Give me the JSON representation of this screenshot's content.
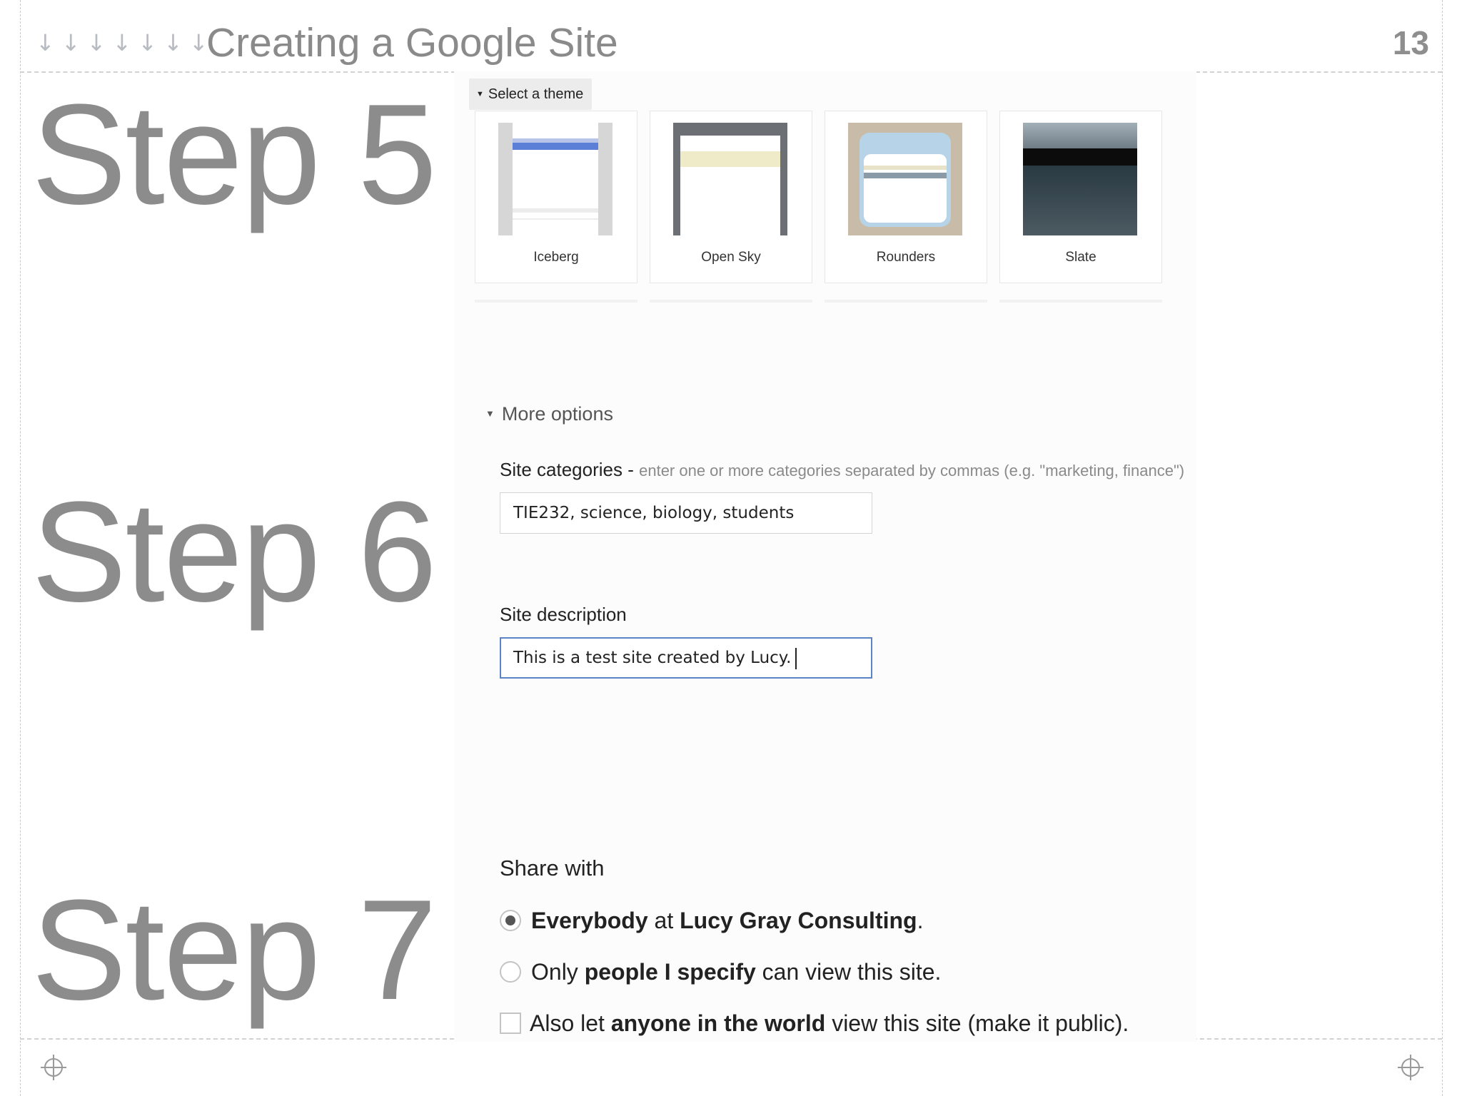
{
  "slide": {
    "title": "Creating a Google Site",
    "page_number": "13",
    "decor_arrows": [
      "↓",
      "↓",
      "↓",
      "↓",
      "↓",
      "↓",
      "↓"
    ]
  },
  "steps": {
    "step5": "Step 5",
    "step6": "Step 6",
    "step7": "Step 7"
  },
  "theme_section": {
    "header": "Select a theme",
    "themes": [
      {
        "name": "Iceberg"
      },
      {
        "name": "Open Sky"
      },
      {
        "name": "Rounders"
      },
      {
        "name": "Slate"
      }
    ]
  },
  "more_options": {
    "label": "More options",
    "categories_label": "Site categories -",
    "categories_hint": "enter one or more categories separated by commas (e.g. \"marketing, finance\")",
    "categories_value": "TIE232, science, biology, students",
    "description_label": "Site description",
    "description_value": "This is a test site created by Lucy."
  },
  "share": {
    "title": "Share with",
    "option1": {
      "bold1": "Everybody",
      "mid": " at ",
      "bold2": "Lucy Gray Consulting",
      "end": ".",
      "selected": true
    },
    "option2": {
      "pre": "Only ",
      "bold": "people I specify",
      "post": " can view this site.",
      "selected": false
    },
    "option3": {
      "pre": "Also let ",
      "bold": "anyone in the world",
      "post": " view this site (make it public).",
      "checked": false
    }
  },
  "colors": {
    "step_text": "#8c8c8c",
    "focus_border": "#5b83c6",
    "iceberg_stripe": "#5b7fd6",
    "slate_dark": "#1f2c33"
  }
}
